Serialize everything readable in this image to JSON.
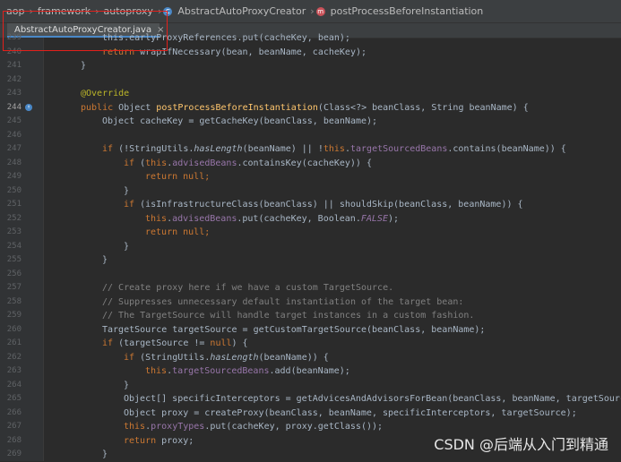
{
  "breadcrumb": {
    "items": [
      "aop",
      "framework",
      "autoproxy",
      "AbstractAutoProxyCreator",
      "postProcessBeforeInstantiation"
    ],
    "class_icon": "C",
    "method_icon": "m"
  },
  "tab": {
    "label": "AbstractAutoProxyCreator.java",
    "close": "×"
  },
  "line_numbers": [
    "239",
    "240",
    "241",
    "242",
    "243",
    "244",
    "245",
    "246",
    "247",
    "248",
    "249",
    "250",
    "251",
    "252",
    "253",
    "254",
    "255",
    "256",
    "257",
    "258",
    "259",
    "260",
    "261",
    "262",
    "263",
    "264",
    "265",
    "266",
    "267",
    "268",
    "269"
  ],
  "code": {
    "l239": [
      "this.earlyProxyReferences.put(cacheKey, bean);"
    ],
    "l240": [
      "return",
      " wrapIfNecessary(bean, beanName, cacheKey);"
    ],
    "l241": [
      "}"
    ],
    "l243": [
      "@Override"
    ],
    "l244": [
      "public",
      " Object ",
      "postProcessBeforeInstantiation",
      "(Class<?> beanClass, String beanName) {"
    ],
    "l245": [
      "Object cacheKey = getCacheKey(beanClass, beanName);"
    ],
    "l247": [
      "if",
      " (!StringUtils.",
      "hasLength",
      "(beanName) || !",
      "this",
      ".",
      "targetSourcedBeans",
      ".contains(beanName)) {"
    ],
    "l248": [
      "if",
      " (",
      "this",
      ".",
      "advisedBeans",
      ".containsKey(cacheKey)) {"
    ],
    "l249": [
      "return null;"
    ],
    "l250": [
      "}"
    ],
    "l251": [
      "if",
      " (isInfrastructureClass(beanClass) || shouldSkip(beanClass, beanName)) {"
    ],
    "l252": [
      "this",
      ".",
      "advisedBeans",
      ".put(cacheKey, Boolean.",
      "FALSE",
      ");"
    ],
    "l253": [
      "return null;"
    ],
    "l254": [
      "}"
    ],
    "l255": [
      "}"
    ],
    "l257": [
      "// Create proxy here if we have a custom TargetSource."
    ],
    "l258": [
      "// Suppresses unnecessary default instantiation of the target bean:"
    ],
    "l259": [
      "// The TargetSource will handle target instances in a custom fashion."
    ],
    "l260": [
      "TargetSource targetSource = getCustomTargetSource(beanClass, beanName);"
    ],
    "l261": [
      "if",
      " (targetSource != ",
      "null",
      ") {"
    ],
    "l262": [
      "if",
      " (StringUtils.",
      "hasLength",
      "(beanName)) {"
    ],
    "l263": [
      "this",
      ".",
      "targetSourcedBeans",
      ".add(beanName);"
    ],
    "l264": [
      "}"
    ],
    "l265": [
      "Object[] specificInterceptors = getAdvicesAndAdvisorsForBean(beanClass, beanName, targetSource"
    ],
    "l266": [
      "Object proxy = createProxy(beanClass, beanName, specificInterceptors, targetSource);"
    ],
    "l267": [
      "this",
      ".",
      "proxyTypes",
      ".put(cacheKey, proxy.getClass());"
    ],
    "l268": [
      "return",
      " proxy;"
    ],
    "l269": [
      "}"
    ]
  },
  "watermark": "CSDN @后端从入门到精通",
  "colors": {
    "keyword": "#cc7832",
    "field": "#9876aa",
    "comment": "#808080",
    "annotation": "#bbb529",
    "method": "#ffc66d",
    "highlight_box": "#e3201b"
  }
}
